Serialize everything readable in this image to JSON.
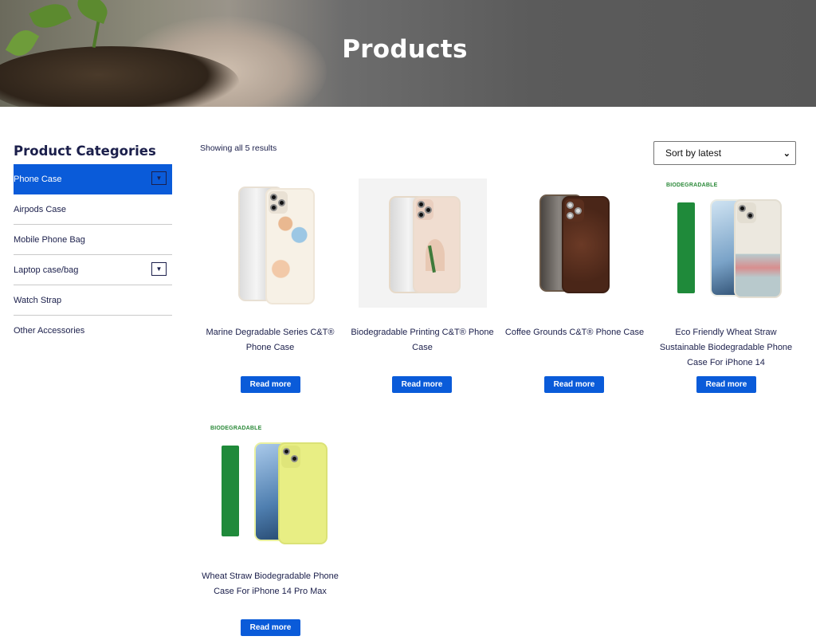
{
  "hero": {
    "title": "Products"
  },
  "sidebar": {
    "title": "Product Categories",
    "items": [
      {
        "label": "Phone Case",
        "active": true,
        "expandable": true
      },
      {
        "label": "Airpods Case",
        "active": false,
        "expandable": false
      },
      {
        "label": "Mobile Phone Bag",
        "active": false,
        "expandable": false
      },
      {
        "label": "Laptop case/bag",
        "active": false,
        "expandable": true
      },
      {
        "label": "Watch Strap",
        "active": false,
        "expandable": false
      },
      {
        "label": "Other Accessories",
        "active": false,
        "expandable": false
      }
    ]
  },
  "results_text": "Showing all 5 results",
  "sort": {
    "selected": "Sort by latest"
  },
  "products": [
    {
      "name": "Marine Degradable Series C&T® Phone Case",
      "button": "Read more"
    },
    {
      "name": "Biodegradable Printing C&T® Phone Case",
      "button": "Read more"
    },
    {
      "name": "Coffee Grounds C&T® Phone Case",
      "button": "Read more"
    },
    {
      "name": "Eco Friendly Wheat Straw Sustainable Biodegradable Phone Case For iPhone 14",
      "button": "Read more",
      "badge": "BIODEGRADABLE"
    },
    {
      "name": "Wheat Straw Biodegradable Phone Case For iPhone 14 Pro Max",
      "button": "Read more",
      "badge": "BIODEGRADABLE"
    }
  ],
  "colors": {
    "accent": "#0a5bd9",
    "text": "#1b1f4b",
    "badge_green": "#2c8a3a"
  }
}
